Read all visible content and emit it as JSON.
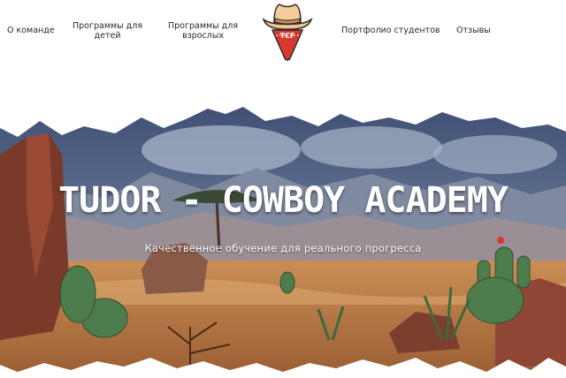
{
  "nav": {
    "items": [
      {
        "label": "О команде"
      },
      {
        "label_line1": "Программы для",
        "label_line2": "детей"
      },
      {
        "label_line1": "Программы для",
        "label_line2": "взрослых"
      },
      {
        "label": "Портфолио студентов"
      },
      {
        "label": "Отзывы"
      }
    ],
    "logo": {
      "text": "TCF",
      "icon": "cowboy-hat-bandana-logo"
    }
  },
  "hero": {
    "title": "TUDOR - COWBOY ACADEMY",
    "subtitle": "Качественное обучение для реального прогресса"
  },
  "colors": {
    "sky": "#4a5d80",
    "sand": "#b77a45",
    "rock": "#7a3a2a",
    "cactus": "#4d7d4c",
    "hat": "#f2c38e",
    "bandana": "#d8392f"
  }
}
